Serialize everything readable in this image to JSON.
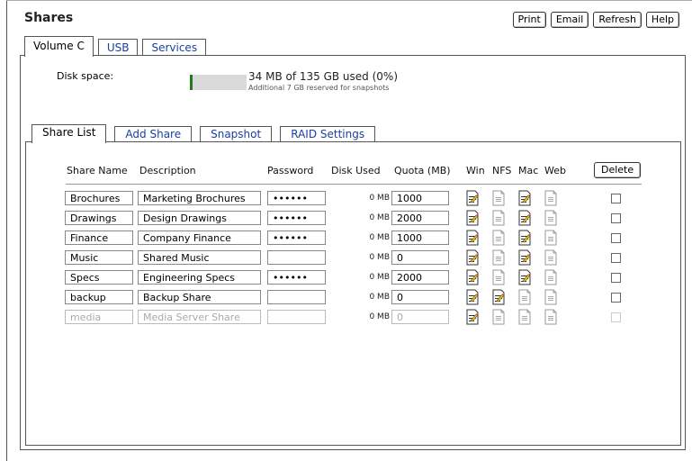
{
  "window": {
    "title": "Shares"
  },
  "toolbar": {
    "print": "Print",
    "email": "Email",
    "refresh": "Refresh",
    "help": "Help"
  },
  "volume_tabs": [
    {
      "label": "Volume C",
      "active": true
    },
    {
      "label": "USB",
      "active": false
    },
    {
      "label": "Services",
      "active": false
    }
  ],
  "disk": {
    "label": "Disk space:",
    "summary": "34 MB of 135 GB used (0%)",
    "note": "Additional 7 GB reserved for snapshots",
    "used_fraction": 0.0,
    "bar_color": "#1e7d1e"
  },
  "share_tabs": [
    {
      "label": "Share List",
      "active": true
    },
    {
      "label": "Add Share",
      "active": false
    },
    {
      "label": "Snapshot",
      "active": false
    },
    {
      "label": "RAID Settings",
      "active": false
    }
  ],
  "columns": {
    "name": "Share Name",
    "description": "Description",
    "password": "Password",
    "disk_used": "Disk Used",
    "quota": "Quota (MB)",
    "win": "Win",
    "nfs": "NFS",
    "mac": "Mac",
    "web": "Web"
  },
  "delete_label": "Delete",
  "shares": [
    {
      "name": "Brochures",
      "description": "Marketing Brochures",
      "password": "••••••",
      "disk_used": "0 MB",
      "quota": "1000",
      "win": true,
      "nfs": false,
      "mac": true,
      "web": false,
      "disabled": false
    },
    {
      "name": "Drawings",
      "description": "Design Drawings",
      "password": "••••••",
      "disk_used": "0 MB",
      "quota": "2000",
      "win": true,
      "nfs": false,
      "mac": true,
      "web": false,
      "disabled": false
    },
    {
      "name": "Finance",
      "description": "Company Finance",
      "password": "••••••",
      "disk_used": "0 MB",
      "quota": "1000",
      "win": true,
      "nfs": false,
      "mac": true,
      "web": false,
      "disabled": false
    },
    {
      "name": "Music",
      "description": "Shared Music",
      "password": "",
      "disk_used": "0 MB",
      "quota": "0",
      "win": true,
      "nfs": false,
      "mac": true,
      "web": false,
      "disabled": false
    },
    {
      "name": "Specs",
      "description": "Engineering Specs",
      "password": "••••••",
      "disk_used": "0 MB",
      "quota": "2000",
      "win": true,
      "nfs": false,
      "mac": true,
      "web": false,
      "disabled": false
    },
    {
      "name": "backup",
      "description": "Backup Share",
      "password": "",
      "disk_used": "0 MB",
      "quota": "0",
      "win": true,
      "nfs": true,
      "mac": false,
      "web": false,
      "disabled": false
    },
    {
      "name": "media",
      "description": "Media Server Share",
      "password": "",
      "disk_used": "0 MB",
      "quota": "0",
      "win": true,
      "nfs": false,
      "mac": false,
      "web": false,
      "disabled": true
    }
  ]
}
